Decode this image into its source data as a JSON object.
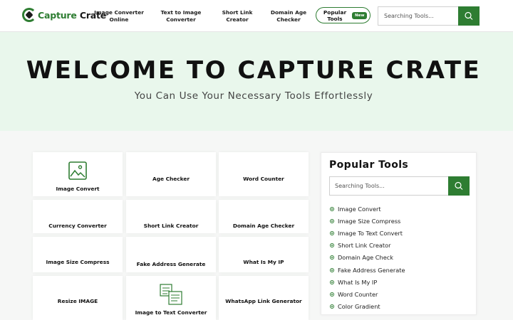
{
  "logo": {
    "part1": "Capture",
    "part2": "Crate"
  },
  "nav": {
    "items": [
      {
        "label_line1": "Image Converter",
        "label_line2": "Online"
      },
      {
        "label_line1": "Text to Image",
        "label_line2": "Converter"
      },
      {
        "label_line1": "Short Link",
        "label_line2": "Creator"
      },
      {
        "label_line1": "Domain Age",
        "label_line2": "Checker"
      }
    ],
    "popular": {
      "label_line1": "Popular",
      "label_line2": "Tools",
      "badge": "New"
    },
    "search": {
      "placeholder": "Searching Tools..."
    }
  },
  "hero": {
    "title": "WELCOME TO CAPTURE CRATE",
    "subtitle": "You Can Use Your Necessary Tools Effortlessly"
  },
  "tools": [
    {
      "label": "Image Convert",
      "icon": "image-icon"
    },
    {
      "label": "Age Checker"
    },
    {
      "label": "Word Counter"
    },
    {
      "label": "Currency Converter"
    },
    {
      "label": "Short Link Creator"
    },
    {
      "label": "Domain Age Checker"
    },
    {
      "label": "Image Size Compress"
    },
    {
      "label": "Fake Address Generate"
    },
    {
      "label": "What Is My IP"
    },
    {
      "label": "Resize IMAGE"
    },
    {
      "label": "Image to Text Converter",
      "icon": "image-to-text-icon"
    },
    {
      "label": "WhatsApp Link Generator"
    }
  ],
  "sidebar": {
    "title": "Popular Tools",
    "search": {
      "placeholder": "Searching Tools..."
    },
    "items": [
      "Image Convert",
      "Image Size Compress",
      "Image To Text Convert",
      "Short Link Creator",
      "Domain Age Check",
      "Fake Address Generate",
      "What Is My IP",
      "Word Counter",
      "Color Gradient"
    ]
  },
  "colors": {
    "brand": "#2e7d32",
    "hero_bg": "#e9f7ec"
  }
}
